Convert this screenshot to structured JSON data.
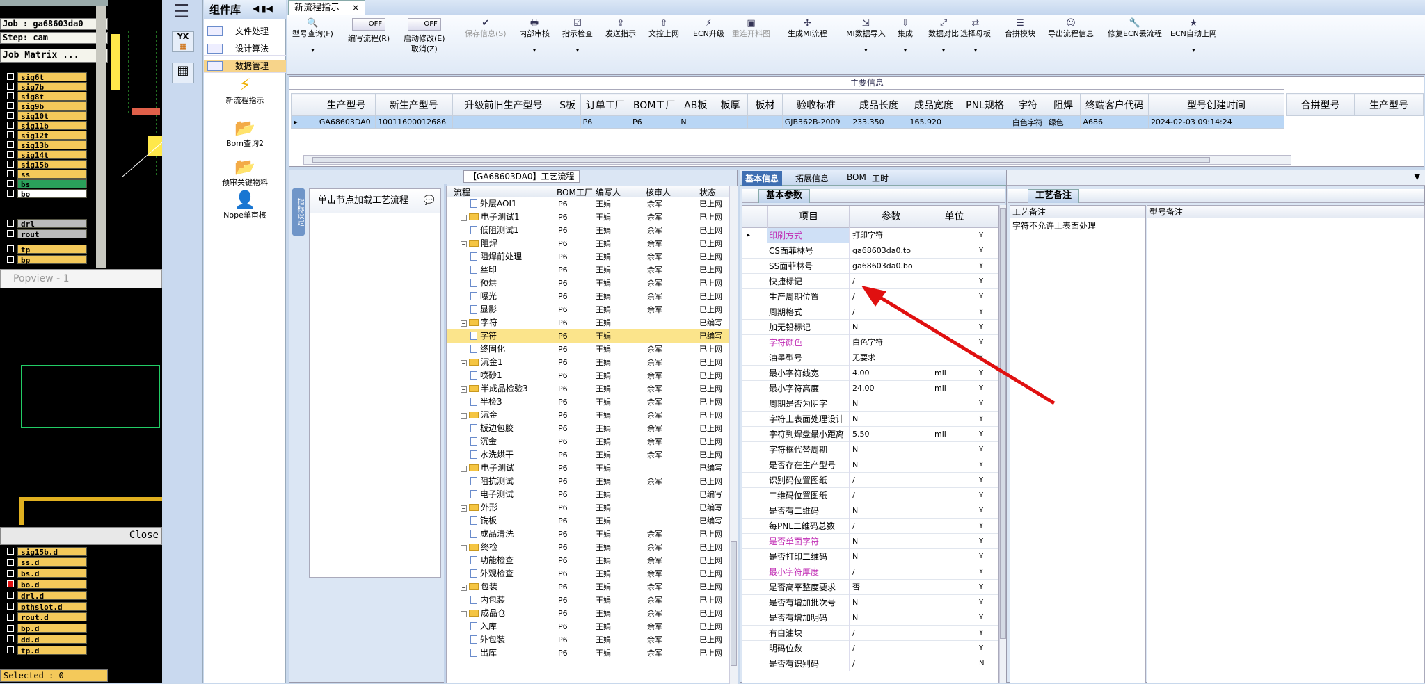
{
  "cam": {
    "job": "Job : ga68603da0",
    "step": "Step: cam",
    "matrix": "Job Matrix ...",
    "layers": [
      "sig6t",
      "sig7b",
      "sig8t",
      "sig9b",
      "sig10t",
      "sig11b",
      "sig12t",
      "sig13b",
      "sig14t",
      "sig15b",
      "ss",
      "bs",
      "bo"
    ],
    "layers2": [
      "drl",
      "rout"
    ],
    "layers3": [
      "tp",
      "bp"
    ],
    "popview": "Popview - 1",
    "close": "Close",
    "lower_layers": [
      "sig15b.d",
      "ss.d",
      "bs.d",
      "bo.d",
      "drl.d",
      "pthslot.d",
      "rout.d",
      "bp.d",
      "dd.d",
      "tp.d"
    ],
    "selected": "Selected : 0"
  },
  "nav": {
    "title": "组件库",
    "items": [
      "文件处理",
      "设计算法",
      "数据管理"
    ],
    "big_items": [
      "新流程指示",
      "Bom查询2",
      "预审关键物料",
      "Nope单审核"
    ]
  },
  "tab": {
    "title": "新流程指示",
    "close": "×"
  },
  "ribbon": {
    "buttons": [
      {
        "icon": "🔍",
        "label": "型号查询(F)",
        "dd": true
      },
      {
        "icon": "",
        "label": "编写流程(R)",
        "toggle": "OFF"
      },
      {
        "icon": "",
        "label": "启动修改(E)",
        "sub": "取消(Z)",
        "toggle": "OFF"
      },
      {
        "icon": "✔",
        "label": "保存信息(S)",
        "disabled": true
      },
      {
        "icon": "🖶",
        "label": "内部审核",
        "dd": true
      },
      {
        "icon": "☑",
        "label": "指示检查",
        "dd": true
      },
      {
        "icon": "⇪",
        "label": "发送指示"
      },
      {
        "icon": "⇧",
        "label": "文控上网"
      },
      {
        "icon": "⚡",
        "label": "ECN升级"
      },
      {
        "icon": "▣",
        "label": "重连开料图",
        "disabled": true
      },
      {
        "icon": "✢",
        "label": "生成MI流程"
      },
      {
        "icon": "⇲",
        "label": "MI数据导入",
        "dd": true
      },
      {
        "icon": "⇩",
        "label": "集成",
        "dd": true
      },
      {
        "icon": "⤢",
        "label": "数据对比",
        "dd": true
      },
      {
        "icon": "⇄",
        "label": "选择母板",
        "dd": true
      },
      {
        "icon": "☰",
        "label": "合拼模块"
      },
      {
        "icon": "☺",
        "label": "导出流程信息"
      },
      {
        "icon": "🔧",
        "label": "修复ECN丢流程"
      },
      {
        "icon": "★",
        "label": "ECN自动上网",
        "dd": true
      }
    ]
  },
  "main_info": {
    "caption": "主要信息",
    "columns": [
      "生产型号",
      "新生产型号",
      "升级前旧生产型号",
      "S板",
      "订单工厂",
      "BOM工厂",
      "AB板",
      "板厚",
      "板材",
      "验收标准",
      "成品长度",
      "成品宽度",
      "PNL规格",
      "字符",
      "阻焊",
      "终端客户代码",
      "型号创建时间"
    ],
    "row": [
      "GA68603DA0",
      "10011600012686",
      "",
      "",
      "P6",
      "P6",
      "N",
      "",
      "",
      "GJB362B-2009",
      "233.350",
      "165.920",
      "",
      "白色字符",
      "绿色",
      "A686",
      "2024-02-03 09:14:24"
    ],
    "side_columns": [
      "合拼型号",
      "生产型号"
    ]
  },
  "process": {
    "title": "【GA68603DA0】工艺流程",
    "load_hint": "单击节点加载工艺流程",
    "vtab": "指标设定",
    "columns": [
      "流程",
      "BOM工厂",
      "编写人",
      "核审人",
      "状态"
    ],
    "rows": [
      {
        "name": "外层AOI1",
        "lvl": 2,
        "f": "P6",
        "w": "王娟",
        "r": "余军",
        "s": "已上网"
      },
      {
        "name": "电子测试1",
        "lvl": 1,
        "f": "P6",
        "w": "王娟",
        "r": "余军",
        "s": "已上网"
      },
      {
        "name": "低阻测试1",
        "lvl": 2,
        "f": "P6",
        "w": "王娟",
        "r": "余军",
        "s": "已上网"
      },
      {
        "name": "阻焊",
        "lvl": 1,
        "f": "P6",
        "w": "王娟",
        "r": "余军",
        "s": "已上网"
      },
      {
        "name": "阻焊前处理",
        "lvl": 2,
        "f": "P6",
        "w": "王娟",
        "r": "余军",
        "s": "已上网"
      },
      {
        "name": "丝印",
        "lvl": 2,
        "f": "P6",
        "w": "王娟",
        "r": "余军",
        "s": "已上网"
      },
      {
        "name": "预烘",
        "lvl": 2,
        "f": "P6",
        "w": "王娟",
        "r": "余军",
        "s": "已上网"
      },
      {
        "name": "曝光",
        "lvl": 2,
        "f": "P6",
        "w": "王娟",
        "r": "余军",
        "s": "已上网"
      },
      {
        "name": "显影",
        "lvl": 2,
        "f": "P6",
        "w": "王娟",
        "r": "余军",
        "s": "已上网"
      },
      {
        "name": "字符",
        "lvl": 1,
        "f": "P6",
        "w": "王娟",
        "r": "",
        "s": "已编写"
      },
      {
        "name": "字符",
        "lvl": 2,
        "f": "P6",
        "w": "王娟",
        "r": "",
        "s": "已编写",
        "hl": true
      },
      {
        "name": "终固化",
        "lvl": 2,
        "f": "P6",
        "w": "王娟",
        "r": "余军",
        "s": "已上网"
      },
      {
        "name": "沉金1",
        "lvl": 1,
        "f": "P6",
        "w": "王娟",
        "r": "余军",
        "s": "已上网"
      },
      {
        "name": "喷砂1",
        "lvl": 2,
        "f": "P6",
        "w": "王娟",
        "r": "余军",
        "s": "已上网"
      },
      {
        "name": "半成品检验3",
        "lvl": 1,
        "f": "P6",
        "w": "王娟",
        "r": "余军",
        "s": "已上网"
      },
      {
        "name": "半检3",
        "lvl": 2,
        "f": "P6",
        "w": "王娟",
        "r": "余军",
        "s": "已上网"
      },
      {
        "name": "沉金",
        "lvl": 1,
        "f": "P6",
        "w": "王娟",
        "r": "余军",
        "s": "已上网"
      },
      {
        "name": "板边包胶",
        "lvl": 2,
        "f": "P6",
        "w": "王娟",
        "r": "余军",
        "s": "已上网"
      },
      {
        "name": "沉金",
        "lvl": 2,
        "f": "P6",
        "w": "王娟",
        "r": "余军",
        "s": "已上网"
      },
      {
        "name": "水洗烘干",
        "lvl": 2,
        "f": "P6",
        "w": "王娟",
        "r": "余军",
        "s": "已上网"
      },
      {
        "name": "电子测试",
        "lvl": 1,
        "f": "P6",
        "w": "王娟",
        "r": "",
        "s": "已编写"
      },
      {
        "name": "阻抗测试",
        "lvl": 2,
        "f": "P6",
        "w": "王娟",
        "r": "余军",
        "s": "已上网"
      },
      {
        "name": "电子测试",
        "lvl": 2,
        "f": "P6",
        "w": "王娟",
        "r": "",
        "s": "已编写"
      },
      {
        "name": "外形",
        "lvl": 1,
        "f": "P6",
        "w": "王娟",
        "r": "",
        "s": "已编写"
      },
      {
        "name": "铣板",
        "lvl": 2,
        "f": "P6",
        "w": "王娟",
        "r": "",
        "s": "已编写"
      },
      {
        "name": "成品清洗",
        "lvl": 2,
        "f": "P6",
        "w": "王娟",
        "r": "余军",
        "s": "已上网"
      },
      {
        "name": "终检",
        "lvl": 1,
        "f": "P6",
        "w": "王娟",
        "r": "余军",
        "s": "已上网"
      },
      {
        "name": "功能检查",
        "lvl": 2,
        "f": "P6",
        "w": "王娟",
        "r": "余军",
        "s": "已上网"
      },
      {
        "name": "外观检查",
        "lvl": 2,
        "f": "P6",
        "w": "王娟",
        "r": "余军",
        "s": "已上网"
      },
      {
        "name": "包装",
        "lvl": 1,
        "f": "P6",
        "w": "王娟",
        "r": "余军",
        "s": "已上网"
      },
      {
        "name": "内包装",
        "lvl": 2,
        "f": "P6",
        "w": "王娟",
        "r": "余军",
        "s": "已上网"
      },
      {
        "name": "成品仓",
        "lvl": 1,
        "f": "P6",
        "w": "王娟",
        "r": "余军",
        "s": "已上网"
      },
      {
        "name": "入库",
        "lvl": 2,
        "f": "P6",
        "w": "王娟",
        "r": "余军",
        "s": "已上网"
      },
      {
        "name": "外包装",
        "lvl": 2,
        "f": "P6",
        "w": "王娟",
        "r": "余军",
        "s": "已上网"
      },
      {
        "name": "出库",
        "lvl": 2,
        "f": "P6",
        "w": "王娟",
        "r": "余军",
        "s": "已上网"
      }
    ]
  },
  "detail": {
    "tabs": [
      "基本信息",
      "拓展信息",
      "BOM",
      "工时"
    ],
    "subtab": "基本参数",
    "columns": [
      "项目",
      "参数",
      "单位"
    ],
    "rows": [
      {
        "k": "印刷方式",
        "v": "打印字符",
        "u": "",
        "y": "Y",
        "pink": true,
        "sel": true
      },
      {
        "k": "CS面菲林号",
        "v": "ga68603da0.to",
        "u": "",
        "y": "Y"
      },
      {
        "k": "SS面菲林号",
        "v": "ga68603da0.bo",
        "u": "",
        "y": "Y"
      },
      {
        "k": "快捷标记",
        "v": "/",
        "u": "",
        "y": "Y"
      },
      {
        "k": "生产周期位置",
        "v": "/",
        "u": "",
        "y": "Y"
      },
      {
        "k": "周期格式",
        "v": "/",
        "u": "",
        "y": "Y"
      },
      {
        "k": "加无铅标记",
        "v": "N",
        "u": "",
        "y": "Y"
      },
      {
        "k": "字符颜色",
        "v": "白色字符",
        "u": "",
        "y": "Y",
        "pink": true
      },
      {
        "k": "油墨型号",
        "v": "无要求",
        "u": "",
        "y": "Y"
      },
      {
        "k": "最小字符线宽",
        "v": "4.00",
        "u": "mil",
        "y": "Y"
      },
      {
        "k": "最小字符高度",
        "v": "24.00",
        "u": "mil",
        "y": "Y"
      },
      {
        "k": "周期是否为阴字",
        "v": "N",
        "u": "",
        "y": "Y"
      },
      {
        "k": "字符上表面处理设计",
        "v": "N",
        "u": "",
        "y": "Y"
      },
      {
        "k": "字符到焊盘最小距离",
        "v": "5.50",
        "u": "mil",
        "y": "Y"
      },
      {
        "k": "字符框代替周期",
        "v": "N",
        "u": "",
        "y": "Y"
      },
      {
        "k": "是否存在生产型号",
        "v": "N",
        "u": "",
        "y": "Y"
      },
      {
        "k": "识别码位置图纸",
        "v": "/",
        "u": "",
        "y": "Y"
      },
      {
        "k": "二维码位置图纸",
        "v": "/",
        "u": "",
        "y": "Y"
      },
      {
        "k": "是否有二维码",
        "v": "N",
        "u": "",
        "y": "Y"
      },
      {
        "k": "每PNL二维码总数",
        "v": "/",
        "u": "",
        "y": "Y"
      },
      {
        "k": "是否单面字符",
        "v": "N",
        "u": "",
        "y": "Y",
        "pink": true
      },
      {
        "k": "是否打印二维码",
        "v": "N",
        "u": "",
        "y": "Y"
      },
      {
        "k": "最小字符厚度",
        "v": "/",
        "u": "",
        "y": "Y",
        "pink": true
      },
      {
        "k": "是否高平整度要求",
        "v": "否",
        "u": "",
        "y": "Y"
      },
      {
        "k": "是否有增加批次号",
        "v": "N",
        "u": "",
        "y": "Y"
      },
      {
        "k": "是否有增加明码",
        "v": "N",
        "u": "",
        "y": "Y"
      },
      {
        "k": "有白油块",
        "v": "/",
        "u": "",
        "y": "Y"
      },
      {
        "k": "明码位数",
        "v": "/",
        "u": "",
        "y": "Y"
      },
      {
        "k": "是否有识别码",
        "v": "/",
        "u": "",
        "y": "N"
      }
    ]
  },
  "notes": {
    "tab": "工艺备注",
    "col1": "工艺备注",
    "col2": "型号备注",
    "text": "字符不允许上表面处理"
  },
  "colors": {
    "accent": "#6f95c8",
    "highlight": "#fbe48b",
    "pink": "#c02cb4",
    "arrow": "#e01010"
  }
}
